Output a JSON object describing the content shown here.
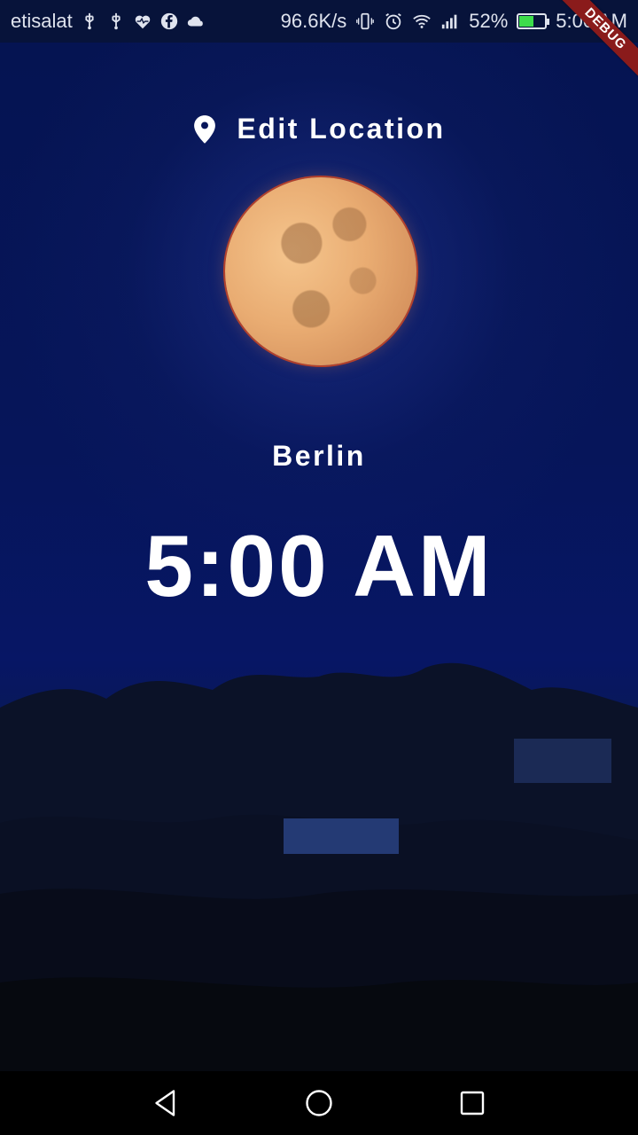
{
  "status_bar": {
    "carrier": "etisalat",
    "network_speed": "96.6K/s",
    "battery": "52%",
    "battery_level": 0.52,
    "time": "5:00 AM",
    "icons": [
      "usb-icon",
      "usb-icon",
      "health-icon",
      "facebook-icon",
      "cloud-icon",
      "vibrate-icon",
      "alarm-icon",
      "wifi-icon",
      "signal-icon",
      "battery-icon"
    ]
  },
  "debug_banner": "DEBUG",
  "app": {
    "edit_location_label": "Edit Location",
    "edit_location_icon": "location-pin-icon",
    "location": "Berlin",
    "time": "5:00 AM"
  },
  "nav_bar": {
    "icons": [
      "back-icon",
      "home-icon",
      "recents-icon"
    ]
  },
  "colors": {
    "sky": "#06155a",
    "text": "#ffffff",
    "debug_ribbon": "#8a1b1b"
  }
}
